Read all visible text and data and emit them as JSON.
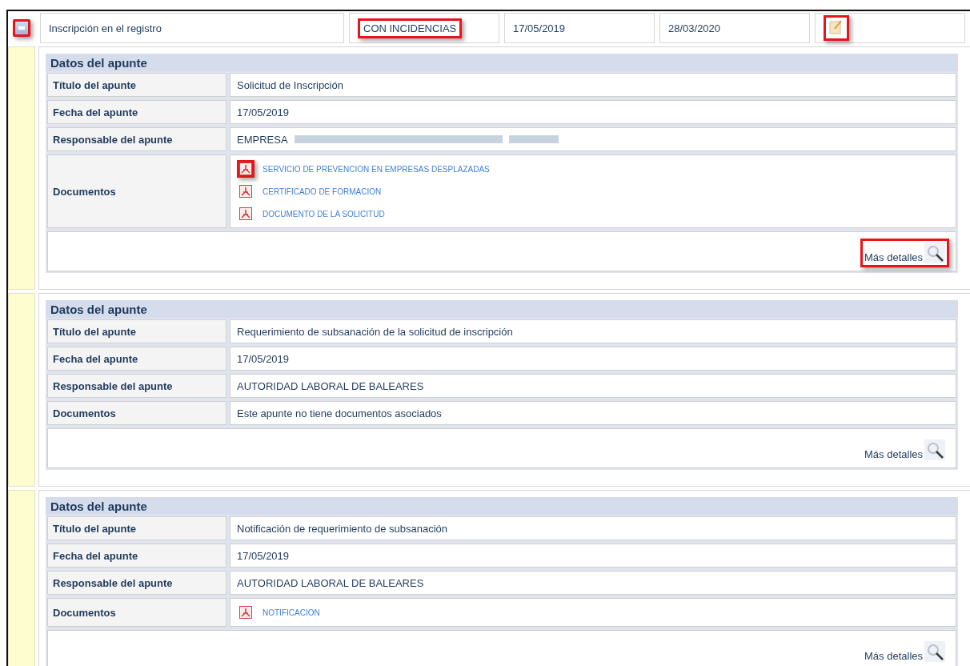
{
  "record": {
    "toggle": {
      "highlighted": true
    },
    "title": "Inscripción en el registro",
    "status": {
      "text": "CON INCIDENCIAS",
      "highlighted": true
    },
    "date_1": "17/05/2019",
    "date_2": "28/03/2020",
    "edit": {
      "highlighted": true
    }
  },
  "entries": [
    {
      "header": "Datos del apunte",
      "fields": [
        {
          "label": "Título del apunte",
          "kind": "text",
          "value": "Solicitud de Inscripción"
        },
        {
          "label": "Fecha del apunte",
          "kind": "text",
          "value": "17/05/2019"
        },
        {
          "label": "Responsable del apunte",
          "kind": "redacted",
          "value": "EMPRESA"
        },
        {
          "label": "Documentos",
          "kind": "documents",
          "documents": [
            {
              "name": "SERVICIO DE PREVENCION EN EMPRESAS DESPLAZADAS",
              "highlighted": true
            },
            {
              "name": "CERTIFICADO DE FORMACION",
              "highlighted": false
            },
            {
              "name": "DOCUMENTO DE LA SOLICITUD",
              "highlighted": false
            }
          ]
        }
      ],
      "more": {
        "text": "Más detalles",
        "highlighted": true
      }
    },
    {
      "header": "Datos del apunte",
      "fields": [
        {
          "label": "Título del apunte",
          "kind": "text",
          "value": "Requerimiento de subsanación de la solicitud de inscripción"
        },
        {
          "label": "Fecha del apunte",
          "kind": "text",
          "value": "17/05/2019"
        },
        {
          "label": "Responsable del apunte",
          "kind": "text",
          "value": "AUTORIDAD LABORAL DE BALEARES"
        },
        {
          "label": "Documentos",
          "kind": "text",
          "value": "Este apunte no tiene documentos asociados"
        }
      ],
      "more": {
        "text": "Más detalles",
        "highlighted": false
      }
    },
    {
      "header": "Datos del apunte",
      "fields": [
        {
          "label": "Título del apunte",
          "kind": "text",
          "value": "Notificación de requerimiento de subsanación"
        },
        {
          "label": "Fecha del apunte",
          "kind": "text",
          "value": "17/05/2019"
        },
        {
          "label": "Responsable del apunte",
          "kind": "text",
          "value": "AUTORIDAD LABORAL DE BALEARES"
        },
        {
          "label": "Documentos",
          "kind": "documents",
          "documents": [
            {
              "name": "NOTIFICACION",
              "highlighted": false
            }
          ]
        }
      ],
      "more": {
        "text": "Más detalles",
        "highlighted": false
      }
    }
  ]
}
